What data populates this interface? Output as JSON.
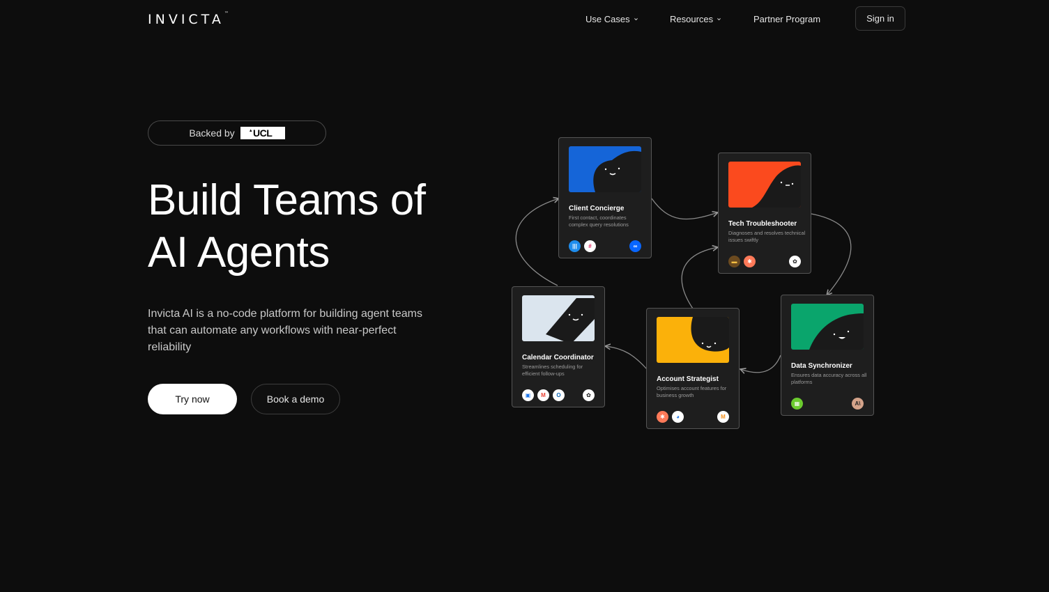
{
  "brand": {
    "logo_text": "INVICTA",
    "tm": "™"
  },
  "nav": {
    "use_cases": "Use Cases",
    "resources": "Resources",
    "partner": "Partner Program",
    "sign_in": "Sign in"
  },
  "hero": {
    "backed_label": "Backed by",
    "backer": "UCL",
    "headline_1": "Build Teams of",
    "headline_2": "AI Agents",
    "subtitle": "Invicta AI is a no-code platform for building agent teams that can automate any workflows with near-perfect reliability",
    "try_now": "Try now",
    "book_demo": "Book a demo"
  },
  "agents": [
    {
      "title": "Client Concierge",
      "desc": "First contact, coordinates complex query resolutions",
      "color": "#1565d8",
      "icons": [
        "intercom-icon",
        "slack-icon"
      ],
      "right_icon": "meta-icon"
    },
    {
      "title": "Tech Troubleshooter",
      "desc": "Diagnoses and resolves technical issues swiftly",
      "color": "#fb4a1e",
      "icons": [
        "folder-icon",
        "hubspot-icon"
      ],
      "right_icon": "openai-icon"
    },
    {
      "title": "Calendar Coordinator",
      "desc": "Streamlines scheduling for efficient follow-ups",
      "color": "#dbe5ee",
      "icons": [
        "google-calendar-icon",
        "gmail-icon",
        "outlook-icon"
      ],
      "right_icon": "openai-icon"
    },
    {
      "title": "Account Strategist",
      "desc": "Optimises account features for business growth",
      "color": "#fbb10a",
      "icons": [
        "hubspot-icon",
        "pipedrive-icon"
      ],
      "right_icon": "mistral-icon"
    },
    {
      "title": "Data Synchronizer",
      "desc": "Ensures data accuracy across all platforms",
      "color": "#0aa56c",
      "icons": [
        "sheets-icon"
      ],
      "right_icon": "anthropic-icon"
    }
  ]
}
